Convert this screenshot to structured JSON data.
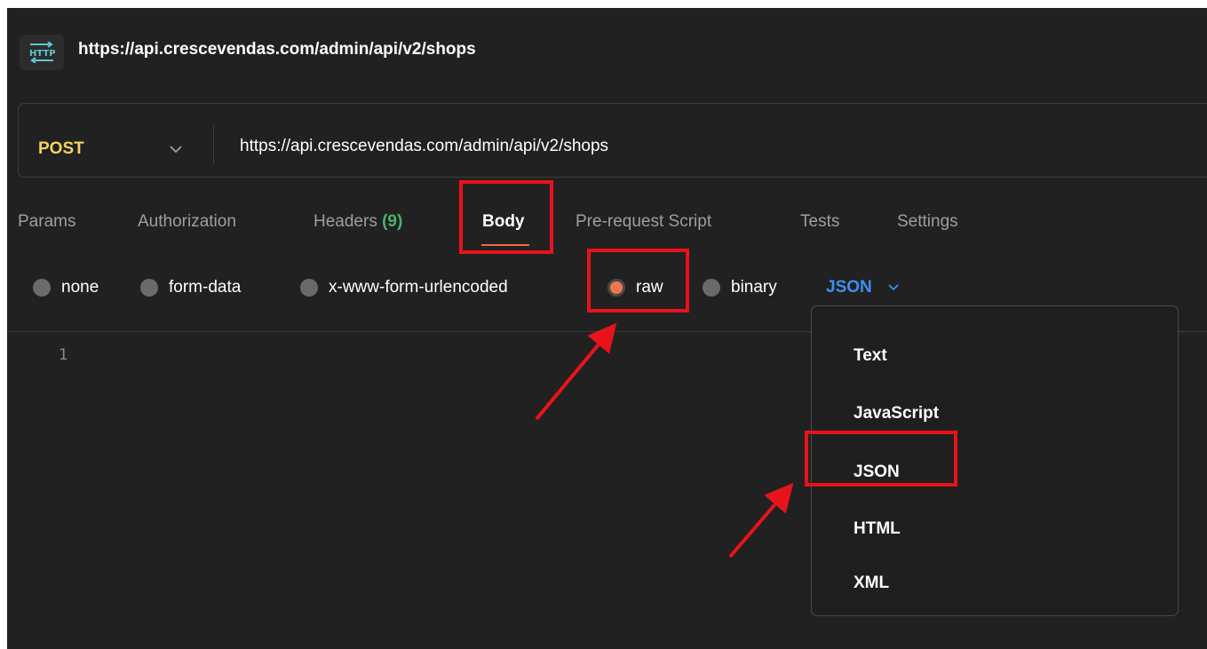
{
  "request": {
    "title": "https://api.crescevendas.com/admin/api/v2/shops",
    "method": "POST",
    "url": "https://api.crescevendas.com/admin/api/v2/shops",
    "icon": "http-icon"
  },
  "tabs": {
    "params": "Params",
    "authorization": "Authorization",
    "headers": "Headers",
    "headers_count": "(9)",
    "body": "Body",
    "prerequest": "Pre-request Script",
    "tests": "Tests",
    "settings": "Settings",
    "active": "Body"
  },
  "body_options": {
    "none": "none",
    "form_data": "form-data",
    "urlencoded": "x-www-form-urlencoded",
    "raw": "raw",
    "binary": "binary",
    "selected": "raw",
    "format": "JSON"
  },
  "editor": {
    "line_number": "1"
  },
  "format_menu": {
    "items": [
      "Text",
      "JavaScript",
      "JSON",
      "HTML",
      "XML"
    ]
  },
  "colors": {
    "background": "#212121",
    "method": "#f5d35c",
    "accent": "#f26b3a",
    "link_blue": "#3e8ef7",
    "count_green": "#49b36b",
    "annotation_red": "#e8121b"
  }
}
